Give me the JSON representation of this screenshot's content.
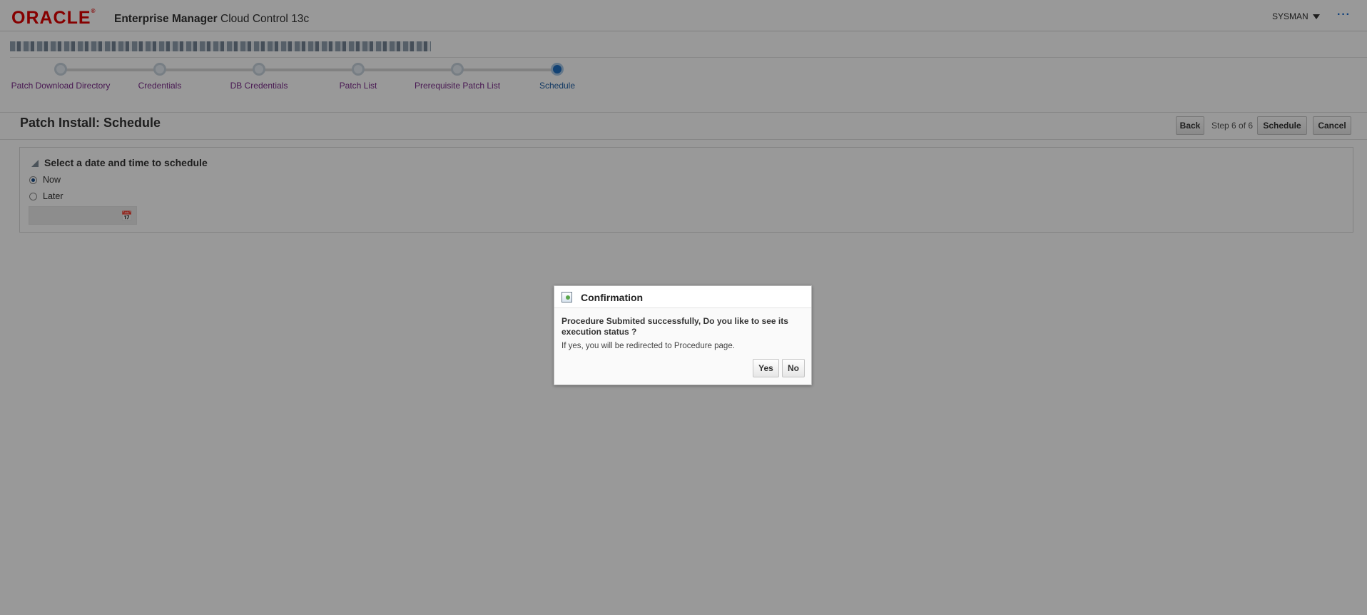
{
  "header": {
    "logo": "ORACLE",
    "product_bold": "Enterprise Manager",
    "product_rest": "Cloud Control 13c",
    "user": "SYSMAN",
    "more_glyph": "···"
  },
  "train": {
    "steps": [
      {
        "label": "Patch Download Directory",
        "state": "visited"
      },
      {
        "label": "Credentials",
        "state": "visited"
      },
      {
        "label": "DB Credentials",
        "state": "visited"
      },
      {
        "label": "Patch List",
        "state": "visited"
      },
      {
        "label": "Prerequisite Patch List",
        "state": "visited"
      },
      {
        "label": "Schedule",
        "state": "current"
      }
    ]
  },
  "page": {
    "title": "Patch Install: Schedule",
    "back_label": "Back",
    "step_text": "Step 6 of 6",
    "schedule_label": "Schedule",
    "cancel_label": "Cancel"
  },
  "schedule_section": {
    "heading": "Select a date and time to schedule",
    "options": [
      {
        "label": "Now",
        "selected": true
      },
      {
        "label": "Later",
        "selected": false
      }
    ],
    "date_value": ""
  },
  "dialog": {
    "title": "Confirmation",
    "message": "Procedure Submited successfully, Do you like to see its execution status ?",
    "sub_message": "If yes, you will be redirected to Procedure page.",
    "yes_label": "Yes",
    "no_label": "No"
  },
  "colors": {
    "oracle_red": "#e00000",
    "train_link": "#7a2a8a",
    "train_current": "#1f6fc1"
  }
}
